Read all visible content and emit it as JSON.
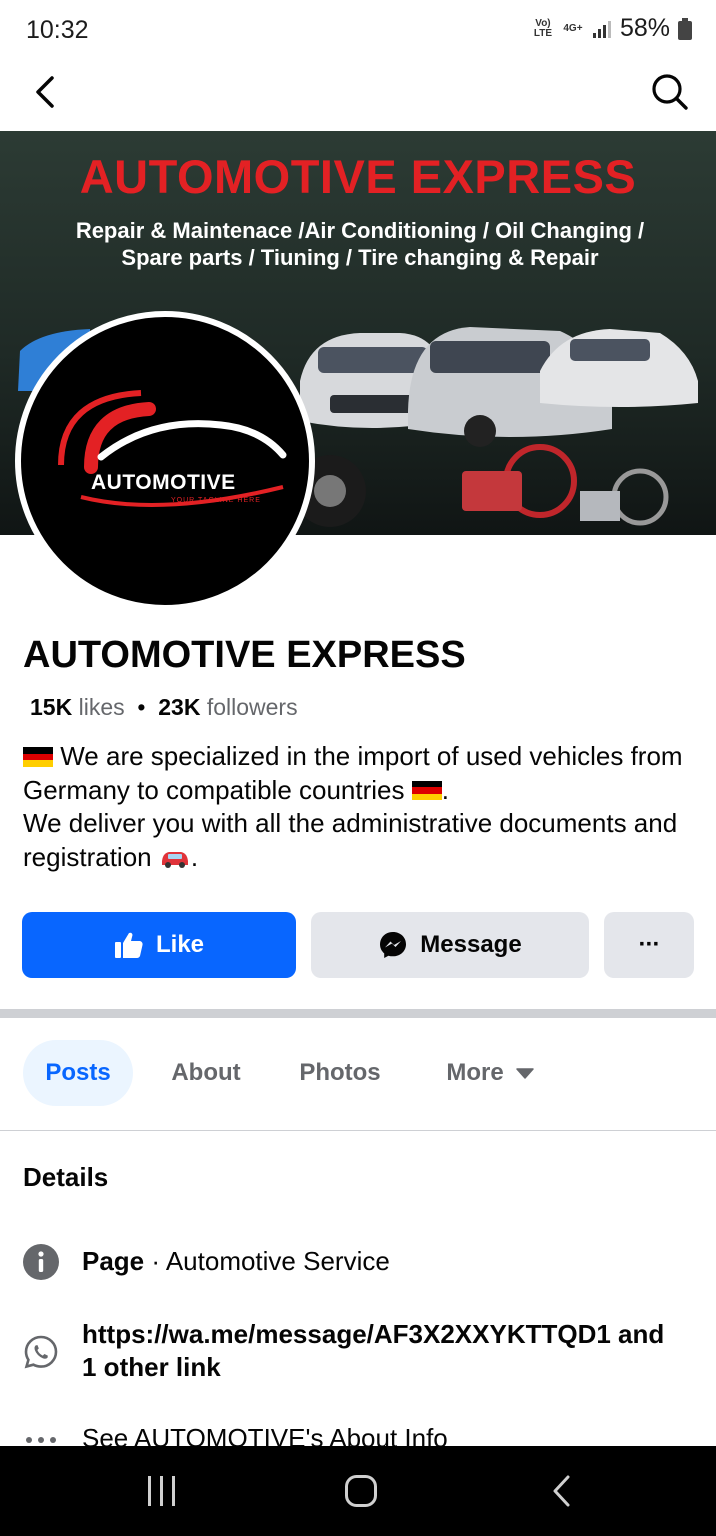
{
  "status": {
    "time": "10:32",
    "network_1": "Vo) LTE",
    "network_2": "4G+",
    "battery": "58%"
  },
  "nav": {
    "back_icon": "chevron-left-icon",
    "search_icon": "search-icon"
  },
  "cover": {
    "title": "AUTOMOTIVE EXPRESS",
    "subtitle": "Repair & Maintenace /Air Conditioning / Oil Changing / Spare parts / Tiuning / Tire changing & Repair"
  },
  "logo": {
    "text": "AUTOMOTIVE",
    "tagline": "YOUR TAGLINE HERE"
  },
  "page": {
    "name": "AUTOMOTIVE EXPRESS",
    "likes_count": "15K",
    "likes_label": "likes",
    "separator": "•",
    "followers_count": "23K",
    "followers_label": "followers",
    "bio_line1": " We are specialized in the import of used vehicles from Germany to compatible countries ",
    "bio_line1_end": ".",
    "bio_line2": "We deliver you with all the administrative documents and registration ",
    "bio_line2_end": "."
  },
  "actions": {
    "like_label": "Like",
    "message_label": "Message",
    "more_label": "···"
  },
  "tabs": {
    "posts": "Posts",
    "about": "About",
    "photos": "Photos",
    "more": "More"
  },
  "details": {
    "title": "Details",
    "page_label": "Page",
    "page_category": " · Automotive Service",
    "link_text": "https://wa.me/message/AF3X2XXYKTTQD1 and 1 other link",
    "about_info": "See AUTOMOTIVE's About Info"
  },
  "colors": {
    "facebook_blue": "#0866ff",
    "cover_red": "#e32124",
    "secondary_text": "#65676b",
    "button_grey": "#e4e6eb"
  }
}
